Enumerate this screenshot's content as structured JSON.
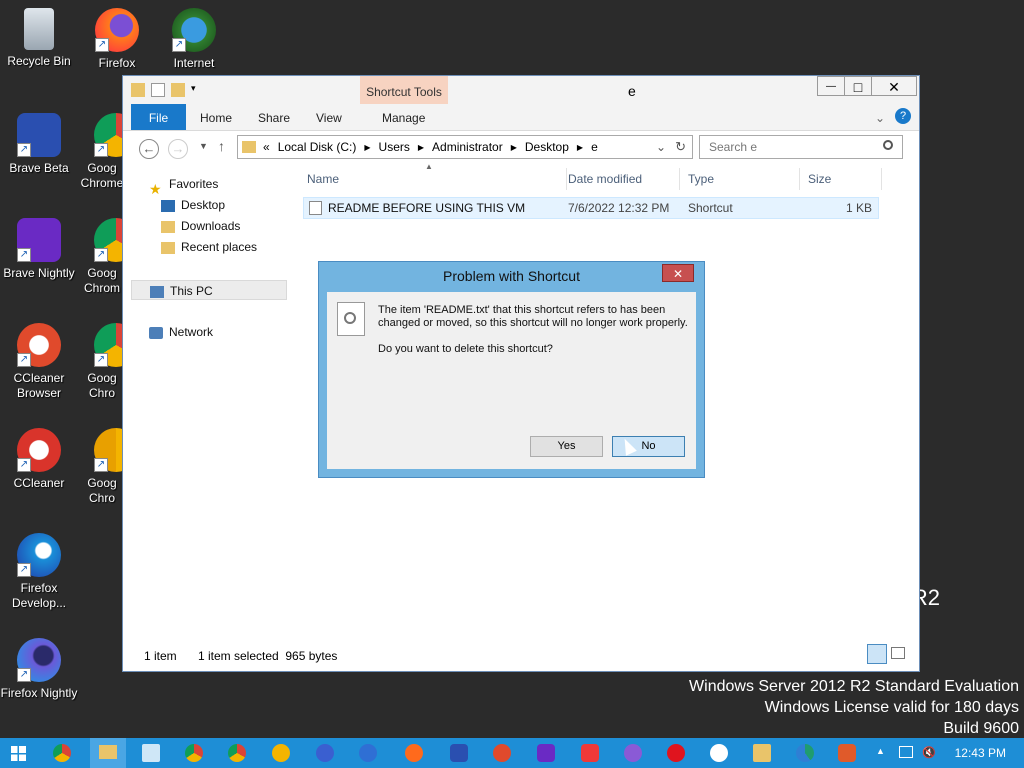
{
  "desktop": {
    "icons": [
      {
        "label": "Recycle Bin",
        "icon": "recycle-bin-icon"
      },
      {
        "label": "Firefox",
        "icon": "firefox-icon"
      },
      {
        "label": "Internet",
        "icon": "internet-download-manager-icon"
      },
      {
        "label": "Brave Beta",
        "icon": "brave-beta-icon"
      },
      {
        "label": "Goog Chrome",
        "icon": "chrome-icon"
      },
      {
        "label": "Brave Nightly",
        "icon": "brave-nightly-icon"
      },
      {
        "label": "Goog Chrom",
        "icon": "chrome-icon"
      },
      {
        "label": "CCleaner Browser",
        "icon": "ccleaner-browser-icon"
      },
      {
        "label": "Goog Chro",
        "icon": "chrome-icon"
      },
      {
        "label": "CCleaner",
        "icon": "ccleaner-icon"
      },
      {
        "label": "Goog Chro",
        "icon": "chrome-canary-icon"
      },
      {
        "label": "Firefox Develop...",
        "icon": "firefox-developer-icon"
      },
      {
        "label": "Firefox Nightly",
        "icon": "firefox-nightly-icon"
      }
    ],
    "watermark": {
      "line1": "Windows Server 2012 R2 Standard Evaluation",
      "line2": "Windows License valid for 180 days",
      "line3": "Build 9600",
      "partial": "R2"
    }
  },
  "explorer": {
    "title": "e",
    "context_tab": "Shortcut Tools",
    "ribbon_tabs": {
      "file": "File",
      "home": "Home",
      "share": "Share",
      "view": "View",
      "manage": "Manage"
    },
    "window_buttons": {
      "minimize": "—",
      "maximize": "□",
      "close": "✕"
    },
    "address": {
      "chevron": "«",
      "segments": [
        "Local Disk (C:)",
        "Users",
        "Administrator",
        "Desktop",
        "e"
      ]
    },
    "search_placeholder": "Search e",
    "nav": {
      "favorites": "Favorites",
      "desktop": "Desktop",
      "downloads": "Downloads",
      "recent": "Recent places",
      "this_pc": "This PC",
      "network": "Network"
    },
    "columns": {
      "name": "Name",
      "date": "Date modified",
      "type": "Type",
      "size": "Size"
    },
    "files": [
      {
        "name": "README BEFORE USING THIS VM",
        "date": "7/6/2022 12:32 PM",
        "type": "Shortcut",
        "size": "1 KB"
      }
    ],
    "status": {
      "count": "1 item",
      "selected": "1 item selected  965 bytes"
    }
  },
  "dialog": {
    "title": "Problem with Shortcut",
    "close": "✕",
    "message": "The item 'README.txt' that this shortcut refers to has been changed or moved, so this shortcut will no longer work properly.",
    "question": "Do you want to delete this shortcut?",
    "yes": "Yes",
    "no": "No"
  },
  "taskbar": {
    "clock": "12:43 PM",
    "apps": [
      "start-icon",
      "chrome-icon",
      "file-explorer-icon",
      "notepad-icon",
      "chrome-beta-icon",
      "chrome-dev-icon",
      "chrome-canary-icon",
      "firefox-developer-icon",
      "firefox-nightly-icon",
      "firefox-icon",
      "brave-icon",
      "ccleaner-browser-icon",
      "brave-nightly-icon",
      "vivaldi-icon",
      "opera-gx-icon",
      "opera-icon",
      "yandex-icon",
      "documents-icon",
      "edge-icon",
      "brave-beta-icon"
    ]
  },
  "colors": {
    "accent": "#1979ca",
    "dialog_frame": "#72b4e0",
    "taskbar": "#1e8ed6",
    "context_tab": "#f7d3c1"
  }
}
